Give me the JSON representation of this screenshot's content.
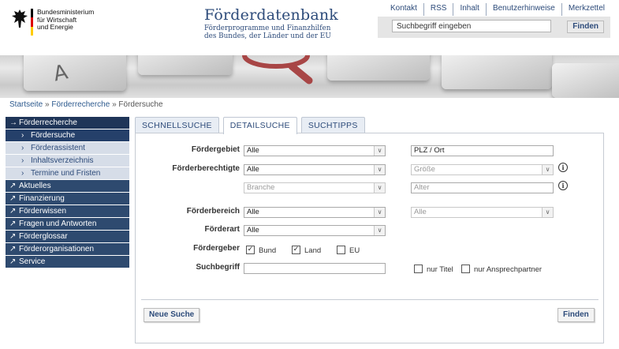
{
  "header": {
    "ministry": "Bundesministerium\nfür Wirtschaft\nund Energie",
    "title": "Förderdatenbank",
    "subtitle": "Förderprogramme und Finanzhilfen\ndes Bundes, der Länder und der EU",
    "topnav": [
      "Kontakt",
      "RSS",
      "Inhalt",
      "Benutzerhinweise",
      "Merkzettel"
    ],
    "search_placeholder": "Suchbegriff eingeben",
    "search_button": "Finden"
  },
  "banner": {
    "key_letter": "A"
  },
  "breadcrumb": {
    "items": [
      "Startseite",
      "Förderrecherche",
      "Fördersuche"
    ],
    "separator": "»"
  },
  "leftnav": {
    "items": [
      {
        "label": "Förderrecherche",
        "icon": "arrow-right-icon"
      },
      {
        "label": "Fördersuche",
        "icon": "chevron-right-icon"
      },
      {
        "label": "Förderassistent",
        "icon": "chevron-right-icon"
      },
      {
        "label": "Inhaltsverzeichnis",
        "icon": "chevron-right-icon"
      },
      {
        "label": "Termine und Fristen",
        "icon": "chevron-right-icon"
      },
      {
        "label": "Aktuelles",
        "icon": "arrow-up-right-icon"
      },
      {
        "label": "Finanzierung",
        "icon": "arrow-up-right-icon"
      },
      {
        "label": "Förderwissen",
        "icon": "arrow-up-right-icon"
      },
      {
        "label": "Fragen und Antworten",
        "icon": "arrow-up-right-icon"
      },
      {
        "label": "Förderglossar",
        "icon": "arrow-up-right-icon"
      },
      {
        "label": "Förderorganisationen",
        "icon": "arrow-up-right-icon"
      },
      {
        "label": "Service",
        "icon": "arrow-up-right-icon"
      }
    ]
  },
  "tabs": [
    "SCHNELLSUCHE",
    "DETAILSUCHE",
    "SUCHTIPPS"
  ],
  "form": {
    "foerdergebiet_label": "Fördergebiet",
    "foerdergebiet_value": "Alle",
    "plz_value": "PLZ / Ort",
    "foerderberechtigte_label": "Förderberechtigte",
    "foerderberechtigte_value": "Alle",
    "groesse_value": "Größe",
    "branche_value": "Branche",
    "alter_placeholder": "Alter",
    "foerderbereich_label": "Förderbereich",
    "foerderbereich_value": "Alle",
    "foerderbereich_sub_value": "Alle",
    "foerderart_label": "Förderart",
    "foerderart_value": "Alle",
    "foerdergeber_label": "Fördergeber",
    "geber": [
      {
        "label": "Bund",
        "checked": true
      },
      {
        "label": "Land",
        "checked": true
      },
      {
        "label": "EU",
        "checked": false
      }
    ],
    "suchbegriff_label": "Suchbegriff",
    "nur_titel": "nur Titel",
    "nur_ansprechpartner": "nur Ansprechpartner",
    "neue_suche": "Neue Suche",
    "finden": "Finden"
  },
  "colors": {
    "brand_blue": "#2d4b7a",
    "nav_dark": "#2e4a6f"
  }
}
